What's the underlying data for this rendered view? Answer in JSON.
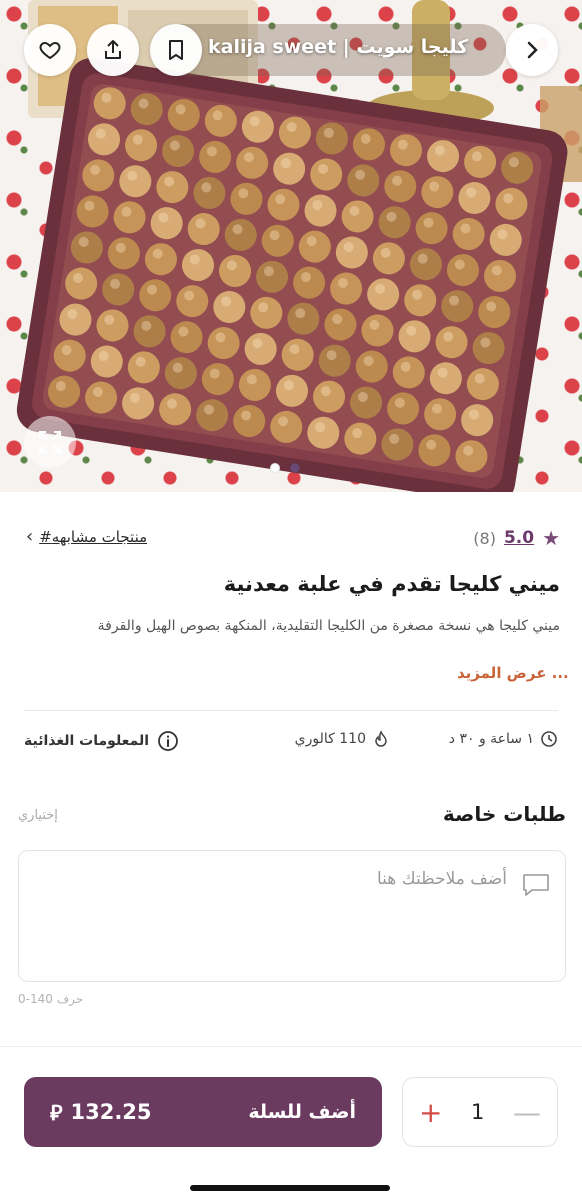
{
  "header": {
    "store_name": "kalija sweet | كليجا سويت",
    "buttons": {
      "favorite": "heart-icon",
      "share": "share-icon",
      "save": "bookmark-icon",
      "forward": "chevron-right-icon"
    }
  },
  "gallery": {
    "image_count": 2,
    "active_index": 0,
    "expand_icon": "expand-icon"
  },
  "product": {
    "rating_value": "5.0",
    "rating_count": "(8)",
    "similar_link": "#منتجات مشابهه",
    "title": "ميني كليجا تقدم في علبة معدنية",
    "description": "ميني كليجا هي نسخة مصغرة من الكليجا التقليدية، المنكهة بصوص الهيل والقرفة",
    "see_more": "... عرض المزيد",
    "prep_time": "١ ساعة و ٣٠ د",
    "calories": "110 كالوري",
    "nutrition_label": "المعلومات الغذائية"
  },
  "special_requests": {
    "title": "طلبات خاصة",
    "optional": "إختياري",
    "placeholder": "أضف ملاحظتك هنا",
    "char_count": "0-140 حرف"
  },
  "cart": {
    "label": "أضف للسلة",
    "price": "132.25",
    "currency_symbol": "⃁",
    "quantity": "1",
    "plus": "+",
    "minus": "—"
  },
  "colors": {
    "brand": "#6b3a5f",
    "accent_orange": "#c8643a",
    "plus_red": "#d44a44"
  }
}
